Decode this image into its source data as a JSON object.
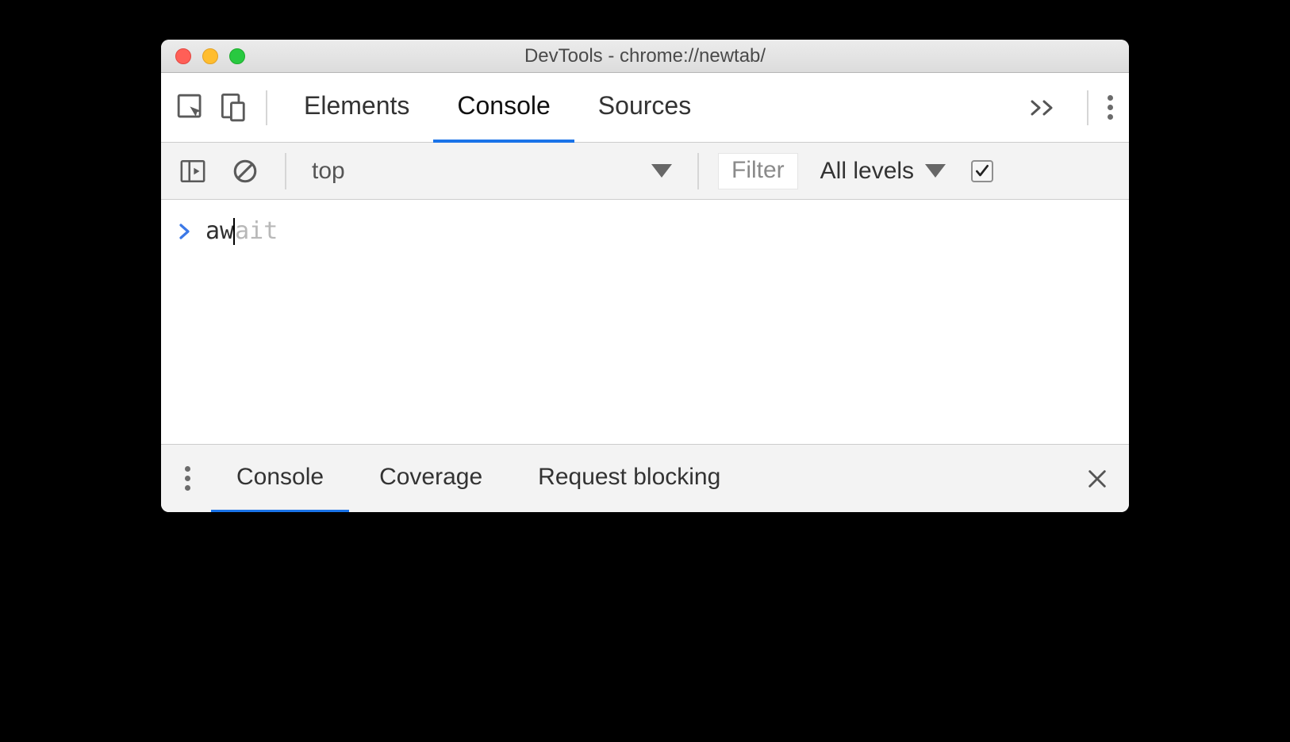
{
  "titlebar": {
    "title": "DevTools - chrome://newtab/"
  },
  "main_tabs": {
    "items": [
      "Elements",
      "Console",
      "Sources"
    ],
    "active_index": 1
  },
  "console_toolbar": {
    "context": "top",
    "filter_placeholder": "Filter",
    "levels_label": "All levels",
    "preserve_checked": true
  },
  "console_input": {
    "typed": "aw",
    "autocomplete_suffix": "ait"
  },
  "drawer": {
    "items": [
      "Console",
      "Coverage",
      "Request blocking"
    ],
    "active_index": 0
  }
}
